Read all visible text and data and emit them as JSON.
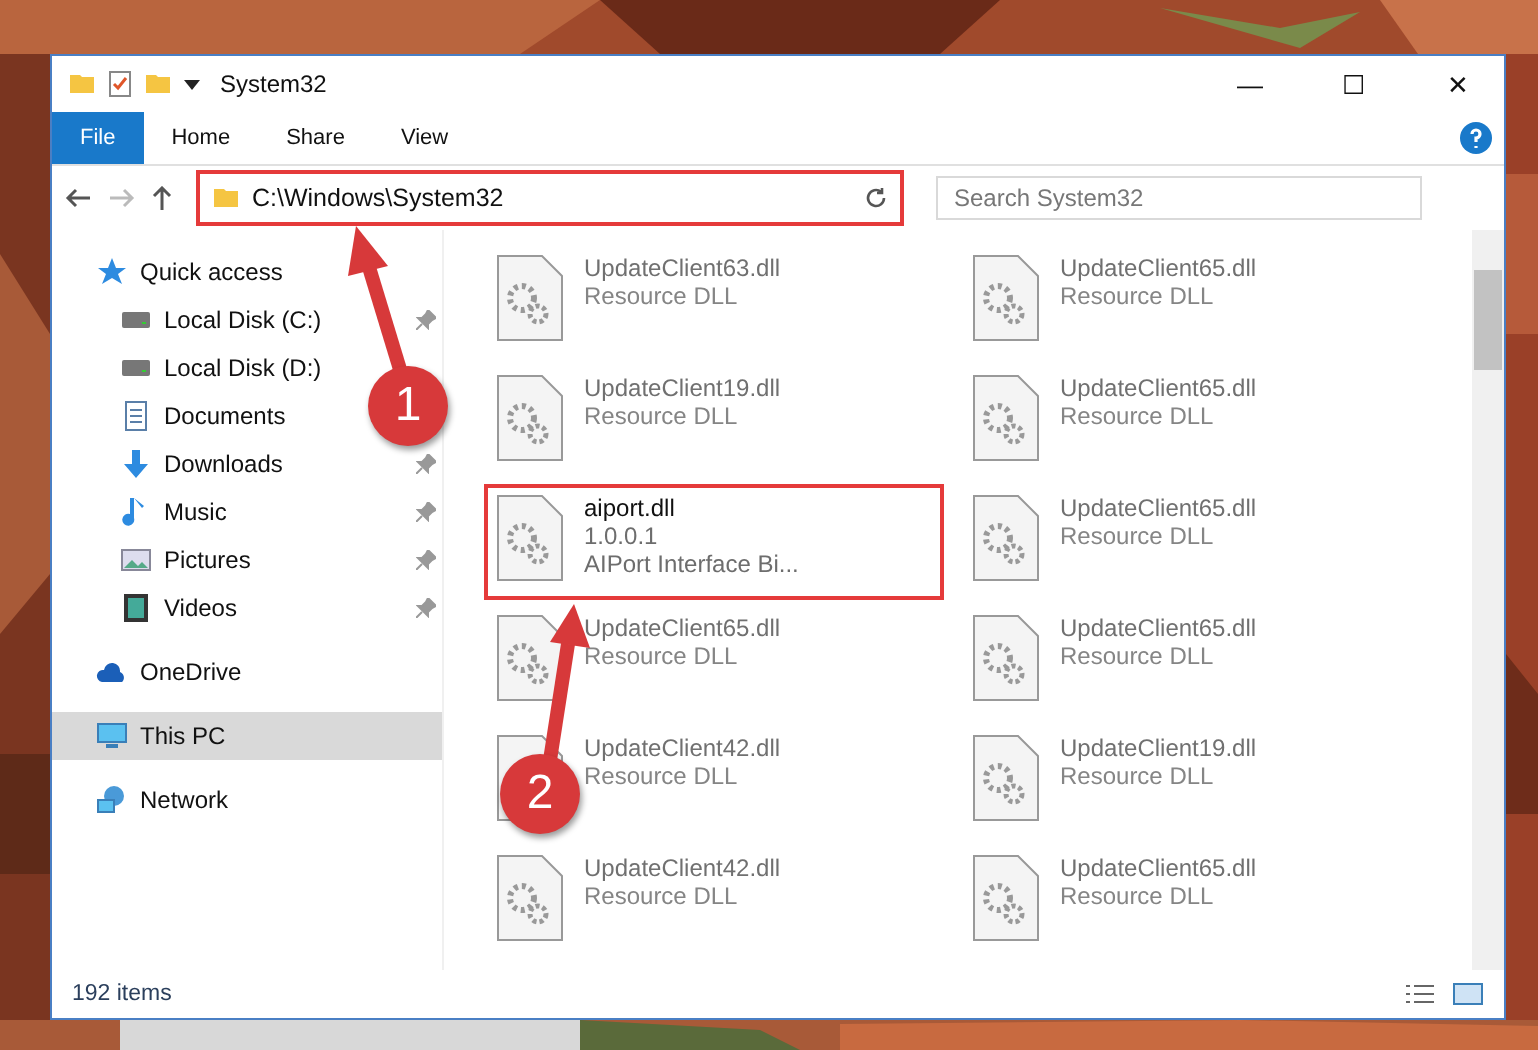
{
  "window": {
    "title": "System32",
    "controls": [
      "—",
      "☐",
      "✕"
    ]
  },
  "ribbon": {
    "tabs": [
      {
        "label": "File",
        "selected": true
      },
      {
        "label": "Home",
        "selected": false
      },
      {
        "label": "Share",
        "selected": false
      },
      {
        "label": "View",
        "selected": false
      }
    ]
  },
  "address": {
    "path": "C:\\Windows\\System32",
    "highlighted": true
  },
  "search": {
    "placeholder": "Search System32"
  },
  "sidebar": {
    "items": [
      {
        "label": "Quick access",
        "selected": false,
        "children": [
          {
            "label": "Local Disk (C:)",
            "selected": false,
            "pinned": true
          },
          {
            "label": "Local Disk (D:)",
            "selected": false,
            "pinned": false
          },
          {
            "label": "Documents",
            "selected": false,
            "pinned": false
          },
          {
            "label": "Downloads",
            "selected": false,
            "pinned": true
          },
          {
            "label": "Music",
            "selected": false,
            "pinned": true
          },
          {
            "label": "Pictures",
            "selected": false,
            "pinned": true
          },
          {
            "label": "Videos",
            "selected": false,
            "pinned": true
          }
        ]
      },
      {
        "label": "OneDrive",
        "selected": false
      },
      {
        "label": "This PC",
        "selected": true
      },
      {
        "label": "Network",
        "selected": false
      }
    ]
  },
  "files": [
    {
      "name": "UpdateClient63.dll",
      "details": [
        "Resource DLL"
      ],
      "dimmed": true,
      "highlighted": false
    },
    {
      "name": "UpdateClient65.dll",
      "details": [
        "Resource DLL"
      ],
      "dimmed": true,
      "highlighted": false
    },
    {
      "name": "UpdateClient19.dll",
      "details": [
        "Resource DLL"
      ],
      "dimmed": true,
      "highlighted": false
    },
    {
      "name": "UpdateClient65.dll",
      "details": [
        "Resource DLL"
      ],
      "dimmed": true,
      "highlighted": false
    },
    {
      "name": "aiport.dll",
      "details": [
        "1.0.0.1",
        "AIPort Interface Bi..."
      ],
      "dimmed": false,
      "highlighted": true
    },
    {
      "name": "UpdateClient65.dll",
      "details": [
        "Resource DLL"
      ],
      "dimmed": true,
      "highlighted": false
    },
    {
      "name": "UpdateClient65.dll",
      "details": [
        "Resource DLL"
      ],
      "dimmed": true,
      "highlighted": false
    },
    {
      "name": "UpdateClient65.dll",
      "details": [
        "Resource DLL"
      ],
      "dimmed": true,
      "highlighted": false
    },
    {
      "name": "UpdateClient42.dll",
      "details": [
        "Resource DLL"
      ],
      "dimmed": true,
      "highlighted": false
    },
    {
      "name": "UpdateClient19.dll",
      "details": [
        "Resource DLL"
      ],
      "dimmed": true,
      "highlighted": false
    },
    {
      "name": "UpdateClient42.dll",
      "details": [
        "Resource DLL"
      ],
      "dimmed": true,
      "highlighted": false
    },
    {
      "name": "UpdateClient65.dll",
      "details": [
        "Resource DLL"
      ],
      "dimmed": true,
      "highlighted": false
    }
  ],
  "status_bar": {
    "count": "192 items"
  },
  "annotations": [
    {
      "label": "1"
    },
    {
      "label": "2"
    }
  ]
}
